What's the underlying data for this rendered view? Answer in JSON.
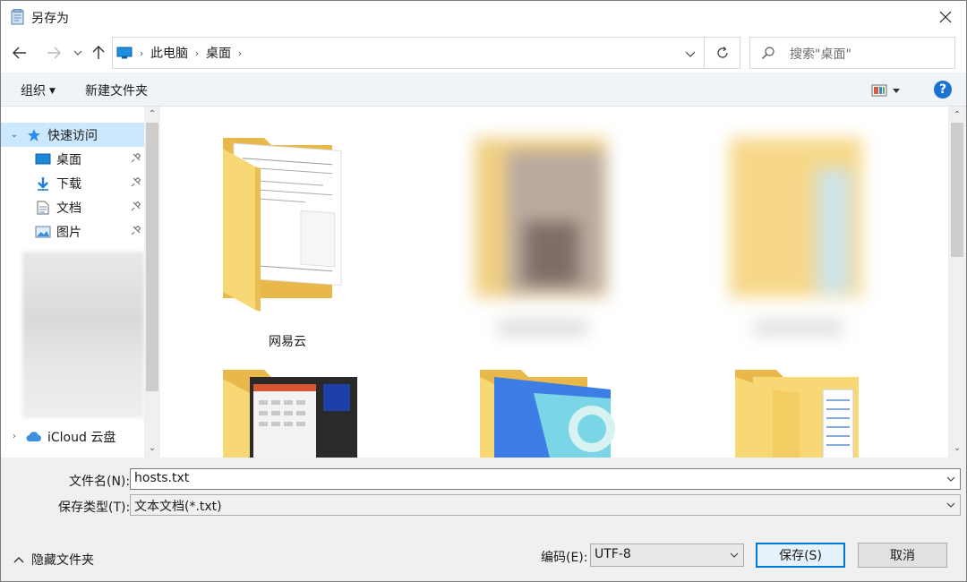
{
  "window": {
    "title": "另存为"
  },
  "address": {
    "path": [
      "此电脑",
      "桌面"
    ]
  },
  "search": {
    "placeholder": "搜索\"桌面\""
  },
  "toolbar": {
    "organize": "组织",
    "new_folder": "新建文件夹",
    "help": "?"
  },
  "nav": {
    "quick_access": "快速访问",
    "items": [
      {
        "label": "桌面",
        "icon": "desktop-icon",
        "pinned": true
      },
      {
        "label": "下载",
        "icon": "download-icon",
        "pinned": true
      },
      {
        "label": "文档",
        "icon": "document-icon",
        "pinned": true
      },
      {
        "label": "图片",
        "icon": "pictures-icon",
        "pinned": true
      }
    ],
    "icloud": "iCloud 云盘"
  },
  "content": {
    "tiles": [
      {
        "label": "网易云",
        "blurred": false
      },
      {
        "label": "",
        "blurred": true
      },
      {
        "label": "",
        "blurred": true
      },
      {
        "label": "",
        "blurred": false
      },
      {
        "label": "",
        "blurred": false
      },
      {
        "label": "",
        "blurred": false
      }
    ]
  },
  "form": {
    "filename_label": "文件名(N):",
    "filename_value": "hosts.txt",
    "filetype_label": "保存类型(T):",
    "filetype_value": "文本文档(*.txt)",
    "encoding_label": "编码(E):",
    "encoding_value": "UTF-8",
    "hide_folders": "隐藏文件夹",
    "save": "保存(S)",
    "cancel": "取消"
  },
  "colors": {
    "accent": "#0078d7",
    "selection": "#cce8ff",
    "folder": "#f8d775",
    "folder_dark": "#e8b84a"
  }
}
